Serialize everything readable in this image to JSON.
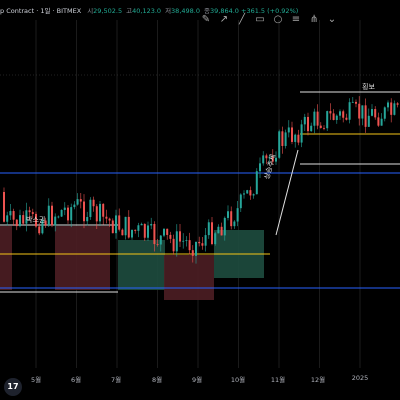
{
  "header": {
    "symbol": "p Contract · 1일 · BITMEX",
    "ohlc": [
      {
        "label": "시",
        "value": "29,502.5"
      },
      {
        "label": "고",
        "value": "40,123.0"
      },
      {
        "label": "저",
        "value": "38,498.0"
      },
      {
        "label": "종",
        "value": "39,864.0 +361.5 (+0.92%)"
      }
    ]
  },
  "toolbar": {
    "tools": [
      "pencil-icon",
      "arrow-icon",
      "ray-icon",
      "rectangle-icon",
      "circle-icon",
      "fib-icon",
      "pitchfork-icon",
      "chevron-down-icon"
    ]
  },
  "annotations": {
    "box_zone": "박스권",
    "uptrend": "상승추세",
    "consolidation": "횡보"
  },
  "logo": {
    "text": "17"
  },
  "colors": {
    "up": "#26a69a",
    "down": "#ef5350",
    "support_line": "#2962ff",
    "mid_line": "#f5c518",
    "box_green": "#1e4d3f",
    "box_red": "#4d1e24"
  },
  "chart_data": {
    "type": "candlestick",
    "x_tick_labels": [
      "5월",
      "6월",
      "7월",
      "8월",
      "9월",
      "10월",
      "11월",
      "12월",
      "2025"
    ],
    "price_trend": [
      {
        "month": "5월",
        "close": 0.45
      },
      {
        "month": "6월",
        "close": 0.52
      },
      {
        "month": "7월",
        "close": 0.44
      },
      {
        "month": "8월",
        "close": 0.38
      },
      {
        "month": "9월",
        "close": 0.36
      },
      {
        "month": "10월",
        "close": 0.5
      },
      {
        "month": "11월",
        "close": 0.78
      },
      {
        "month": "12월",
        "close": 0.88
      },
      {
        "month": "2025",
        "close": 0.9
      }
    ]
  }
}
